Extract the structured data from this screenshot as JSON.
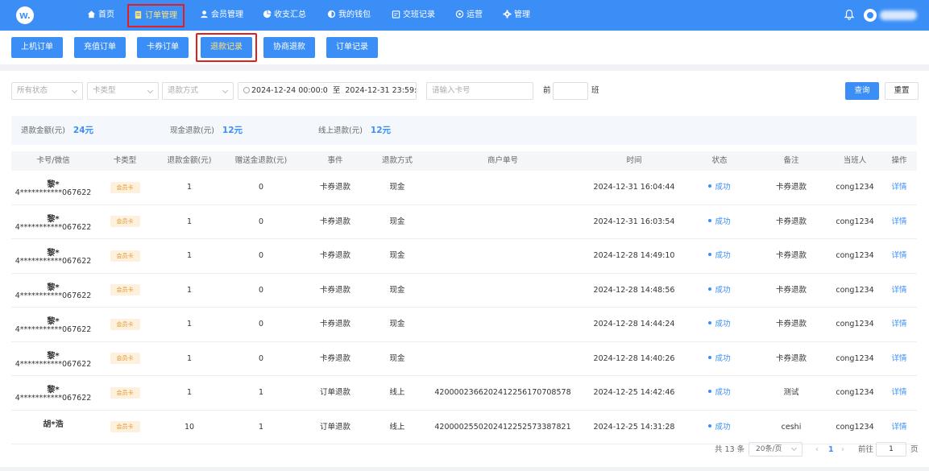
{
  "nav": {
    "logo_letter": "w.",
    "items": [
      {
        "label": "首页",
        "icon": "home-icon"
      },
      {
        "label": "订单管理",
        "icon": "order-icon"
      },
      {
        "label": "会员管理",
        "icon": "member-icon"
      },
      {
        "label": "收支汇总",
        "icon": "pie-icon"
      },
      {
        "label": "我的钱包",
        "icon": "wallet-icon"
      },
      {
        "label": "交班记录",
        "icon": "shift-icon"
      },
      {
        "label": "运营",
        "icon": "operation-icon"
      },
      {
        "label": "管理",
        "icon": "gear-icon"
      }
    ],
    "active_index": 1
  },
  "tabs": [
    "上机订单",
    "充值订单",
    "卡券订单",
    "退款记录",
    "协商退款",
    "订单记录"
  ],
  "active_tab": 3,
  "filters": {
    "status_placeholder": "所有状态",
    "card_type_placeholder": "卡类型",
    "refund_method_placeholder": "退款方式",
    "date_start": "2024-12-24 00:00:0",
    "date_sep": "至",
    "date_end": "2024-12-31 23:59:5",
    "card_no_placeholder": "请输入卡号",
    "shift_prefix": "前",
    "shift_value": "",
    "shift_suffix": "班",
    "query_label": "查询",
    "reset_label": "重置"
  },
  "summary": [
    {
      "label": "退款金额(元)",
      "value": "24元"
    },
    {
      "label": "现金退款(元)",
      "value": "12元"
    },
    {
      "label": "线上退款(元)",
      "value": "12元"
    }
  ],
  "table": {
    "headers": [
      "卡号/微信",
      "卡类型",
      "退款金额(元)",
      "赠送金退款(元)",
      "事件",
      "退款方式",
      "商户单号",
      "时间",
      "状态",
      "备注",
      "当班人",
      "操作"
    ],
    "rows": [
      {
        "name": "黎*",
        "card_no": "4***********067622",
        "card_type": "会员卡",
        "amount": "1",
        "gift": "0",
        "event": "卡券退款",
        "method": "现金",
        "merchant_no": "",
        "time": "2024-12-31 16:04:44",
        "status": "成功",
        "remark": "卡券退款",
        "operator": "cong1234",
        "action": "详情"
      },
      {
        "name": "黎*",
        "card_no": "4***********067622",
        "card_type": "会员卡",
        "amount": "1",
        "gift": "0",
        "event": "卡券退款",
        "method": "现金",
        "merchant_no": "",
        "time": "2024-12-31 16:03:54",
        "status": "成功",
        "remark": "卡券退款",
        "operator": "cong1234",
        "action": "详情"
      },
      {
        "name": "黎*",
        "card_no": "4***********067622",
        "card_type": "会员卡",
        "amount": "1",
        "gift": "0",
        "event": "卡券退款",
        "method": "现金",
        "merchant_no": "",
        "time": "2024-12-28 14:49:10",
        "status": "成功",
        "remark": "卡券退款",
        "operator": "cong1234",
        "action": "详情"
      },
      {
        "name": "黎*",
        "card_no": "4***********067622",
        "card_type": "会员卡",
        "amount": "1",
        "gift": "0",
        "event": "卡券退款",
        "method": "现金",
        "merchant_no": "",
        "time": "2024-12-28 14:48:56",
        "status": "成功",
        "remark": "卡券退款",
        "operator": "cong1234",
        "action": "详情"
      },
      {
        "name": "黎*",
        "card_no": "4***********067622",
        "card_type": "会员卡",
        "amount": "1",
        "gift": "0",
        "event": "卡券退款",
        "method": "现金",
        "merchant_no": "",
        "time": "2024-12-28 14:44:24",
        "status": "成功",
        "remark": "卡券退款",
        "operator": "cong1234",
        "action": "详情"
      },
      {
        "name": "黎*",
        "card_no": "4***********067622",
        "card_type": "会员卡",
        "amount": "1",
        "gift": "0",
        "event": "卡券退款",
        "method": "现金",
        "merchant_no": "",
        "time": "2024-12-28 14:40:26",
        "status": "成功",
        "remark": "卡券退款",
        "operator": "cong1234",
        "action": "详情"
      },
      {
        "name": "黎*",
        "card_no": "4***********067622",
        "card_type": "会员卡",
        "amount": "1",
        "gift": "1",
        "event": "订单退款",
        "method": "线上",
        "merchant_no": "4200002366202412256170708578",
        "time": "2024-12-25 14:42:46",
        "status": "成功",
        "remark": "测试",
        "operator": "cong1234",
        "action": "详情"
      },
      {
        "name": "胡*浩",
        "card_no": "",
        "card_type": "会员卡",
        "amount": "10",
        "gift": "1",
        "event": "订单退款",
        "method": "线上",
        "merchant_no": "4200002550202412252573387821",
        "time": "2024-12-25 14:31:28",
        "status": "成功",
        "remark": "ceshi",
        "operator": "cong1234",
        "action": "详情"
      }
    ]
  },
  "pagination": {
    "total": "共 13 条",
    "page_size": "20条/页",
    "prev": "‹",
    "current": "1",
    "next": "›",
    "goto_label": "前往",
    "goto_value": "1",
    "page_suffix": "页"
  },
  "colors": {
    "primary": "#3a8ef6",
    "highlight_frame": "#e02020",
    "badge_text": "#e8912d"
  }
}
